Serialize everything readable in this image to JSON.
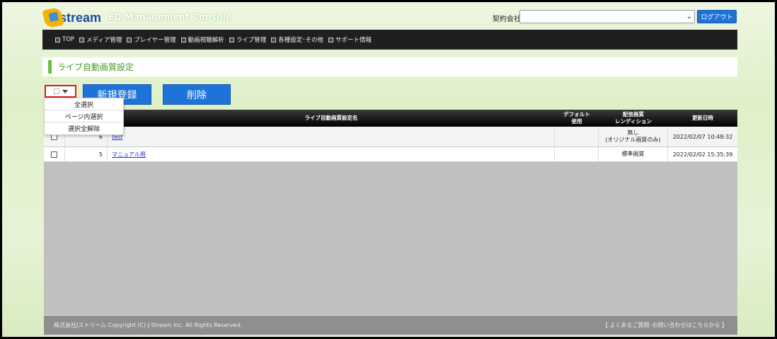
{
  "header": {
    "logo_text": "stream",
    "console_title": "EQ Management Console",
    "company_label": "契約会社:",
    "company_value": "",
    "logout_label": "ログアウト"
  },
  "nav": {
    "items": [
      {
        "label": "TOP"
      },
      {
        "label": "メディア管理"
      },
      {
        "label": "プレイヤー管理"
      },
      {
        "label": "動画視聴解析"
      },
      {
        "label": "ライブ管理"
      },
      {
        "label": "各種設定･その他"
      },
      {
        "label": "サポート情報"
      }
    ]
  },
  "page": {
    "title": "ライブ自動画質設定"
  },
  "toolbar": {
    "new_label": "新規登録",
    "delete_label": "削除"
  },
  "select_menu": {
    "items": [
      "全選択",
      "ページ内選択",
      "選択全解除"
    ]
  },
  "table": {
    "headers": {
      "name": "ライブ自動画質設定名",
      "default": "デフォルト\n使用",
      "rendition": "配信画質\nレンディション",
      "updated": "更新日時"
    },
    "rows": [
      {
        "id": "6",
        "name": "test",
        "default": "",
        "rendition": "無し\n(オリジナル画質のみ)",
        "updated": "2022/02/07 10:48:32"
      },
      {
        "id": "5",
        "name": "マニュアル用",
        "default": "",
        "rendition": "標準画質",
        "updated": "2022/02/02 15:35:39"
      }
    ]
  },
  "footer": {
    "copyright": "株式会社Jストリーム Copyright (C) J-Stream Inc. All Rights Reserved.",
    "faq_link": "【 よくあるご質問･お問い合わせはこちらから 】"
  },
  "colors": {
    "accent_blue": "#1e73d8",
    "title_green": "#4a9a22",
    "highlight_red": "#d02020"
  }
}
